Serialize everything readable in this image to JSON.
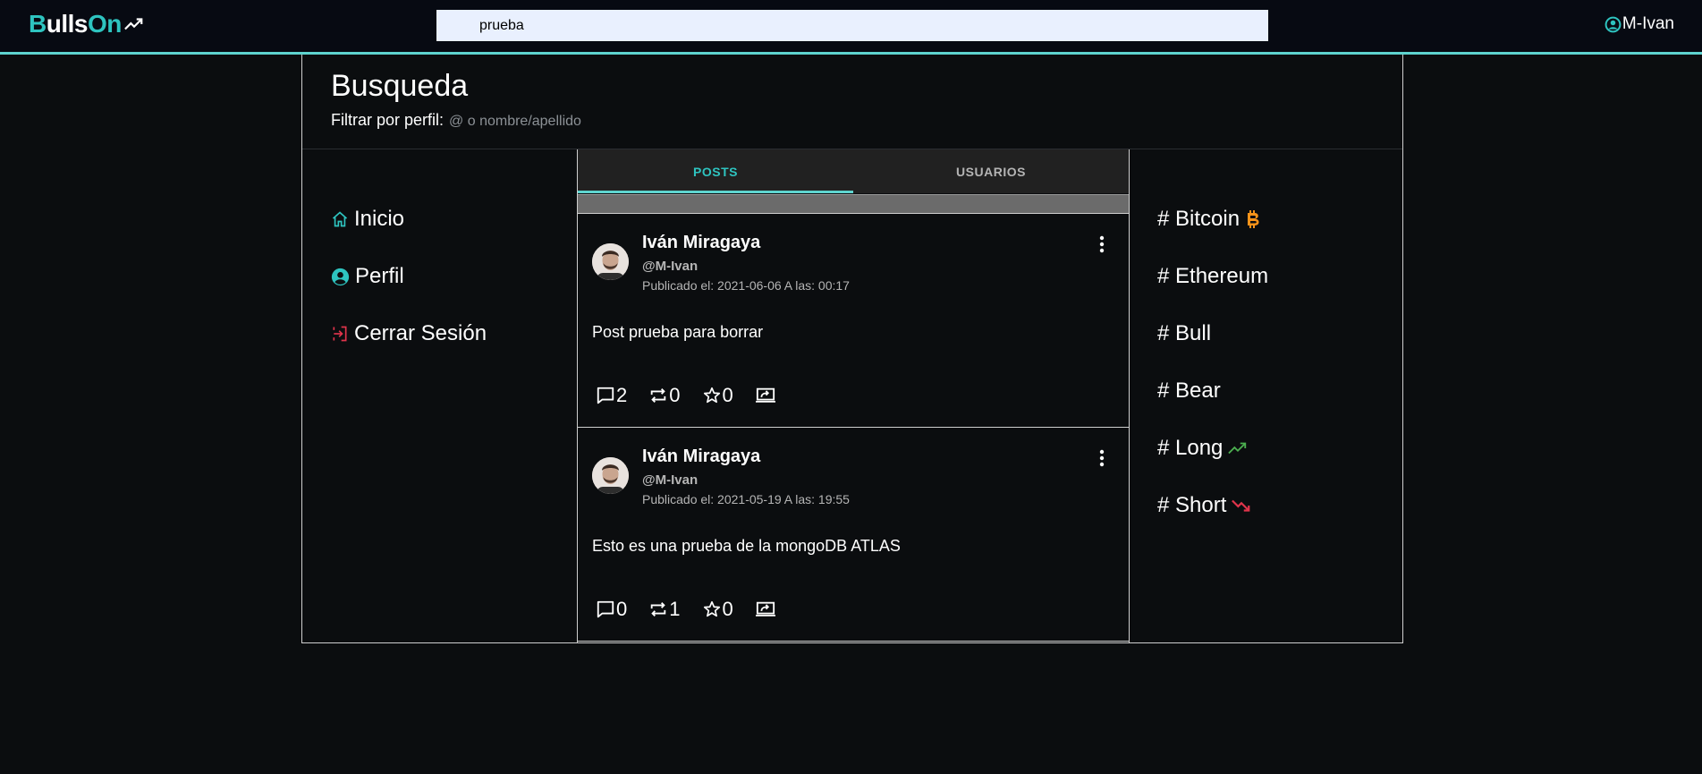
{
  "navbar": {
    "logo_b": "B",
    "logo_ulls": "ulls",
    "logo_on": "On",
    "search_value": "prueba",
    "user_handle": "M-Ivan"
  },
  "header": {
    "title": "Busqueda",
    "filter_label": "Filtrar por perfil:",
    "filter_placeholder": "@ o nombre/apellido"
  },
  "left_nav": {
    "items": [
      {
        "label": "Inicio",
        "icon": "home-icon"
      },
      {
        "label": "Perfil",
        "icon": "account-circle-icon"
      },
      {
        "label": "Cerrar Sesión",
        "icon": "logout-icon"
      }
    ]
  },
  "tabs": [
    {
      "label": "POSTS",
      "active": true
    },
    {
      "label": "USUARIOS",
      "active": false
    }
  ],
  "posts": [
    {
      "author": "Iván Miragaya",
      "handle": "@M-Ivan",
      "date": "Publicado el: 2021-06-06 A las: 00:17",
      "body": "Post prueba para borrar",
      "comments": "2",
      "reposts": "0",
      "likes": "0"
    },
    {
      "author": "Iván Miragaya",
      "handle": "@M-Ivan",
      "date": "Publicado el: 2021-05-19 A las: 19:55",
      "body": "Esto es una prueba de la mongoDB ATLAS",
      "comments": "0",
      "reposts": "1",
      "likes": "0"
    }
  ],
  "trends": [
    {
      "label": "# Bitcoin",
      "icon": "bitcoin-icon"
    },
    {
      "label": "# Ethereum",
      "icon": ""
    },
    {
      "label": "# Bull",
      "icon": ""
    },
    {
      "label": "# Bear",
      "icon": ""
    },
    {
      "label": "# Long",
      "icon": "trending-up-icon"
    },
    {
      "label": "# Short",
      "icon": "trending-down-icon"
    }
  ],
  "colors": {
    "accent": "#2ec4c0",
    "background": "#0b0d0f",
    "navbar": "#070a12",
    "bitcoin": "#f7931a",
    "trend_up": "#4caf50",
    "trend_down": "#e0344b",
    "logout": "#e0344b"
  }
}
